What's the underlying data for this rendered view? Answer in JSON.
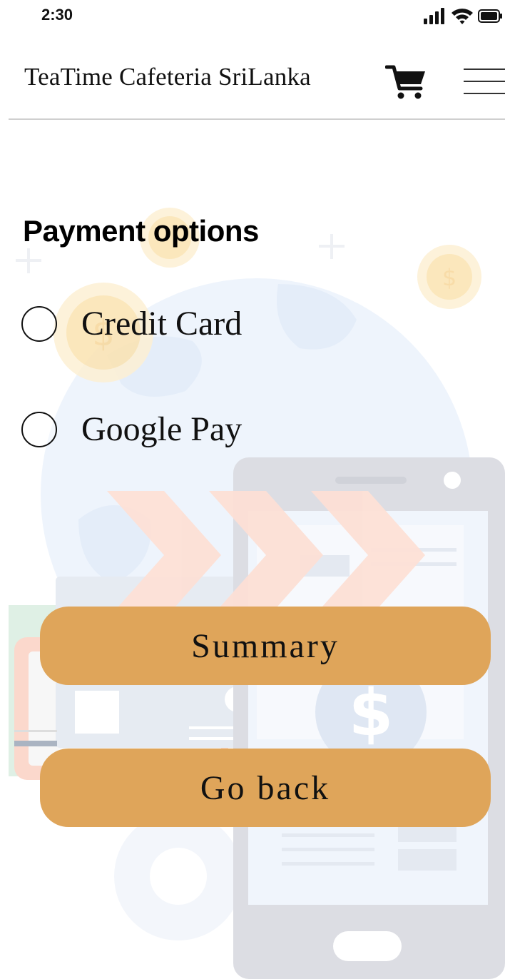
{
  "status_bar": {
    "time": "2:30",
    "icons": [
      "signal-icon",
      "wifi-icon",
      "battery-icon"
    ]
  },
  "header": {
    "title": "TeaTime Cafeteria SriLanka",
    "cart_icon": "cart-icon",
    "menu_icon": "hamburger-menu-icon"
  },
  "main": {
    "section_title": "Payment options",
    "options": [
      {
        "label": "Credit Card",
        "selected": false
      },
      {
        "label": "Google Pay",
        "selected": false
      }
    ],
    "buttons": {
      "summary": "Summary",
      "go_back": "Go back"
    }
  },
  "colors": {
    "button": "#dfa55a",
    "text": "#111111",
    "divider": "#cfcfcf"
  }
}
